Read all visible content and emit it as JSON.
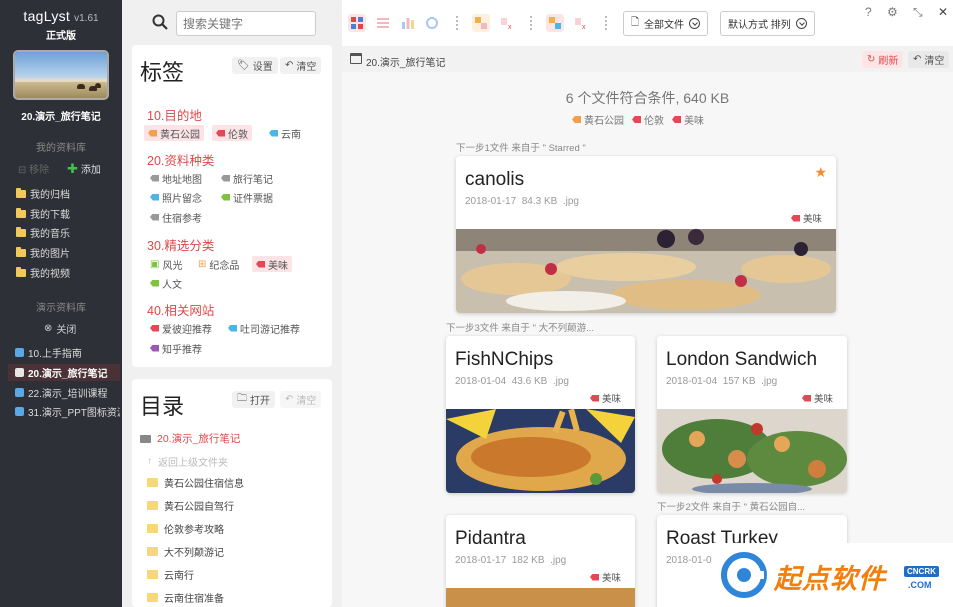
{
  "app": {
    "name": "tagLyst",
    "version": "v1.61",
    "edition": "正式版"
  },
  "sidebar": {
    "library_name": "20.演示_旅行笔记",
    "my_libraries_title": "我的资料库",
    "remove_label": "移除",
    "add_label": "添加",
    "my_folders": [
      "我的归档",
      "我的下载",
      "我的音乐",
      "我的图片",
      "我的视频"
    ],
    "demo_libraries_title": "演示资料库",
    "close_label": "关闭",
    "demo_items": [
      "10.上手指南",
      "20.演示_旅行笔记",
      "22.演示_培训课程",
      "31.演示_PPT图标资源"
    ],
    "active_index": 1
  },
  "search": {
    "placeholder": "搜索关键字"
  },
  "tags_panel": {
    "title": "标签",
    "settings_label": "设置",
    "clear_label": "清空",
    "groups": [
      {
        "name": "10.目的地",
        "tags": [
          "黄石公园",
          "伦敦",
          "云南"
        ]
      },
      {
        "name": "20.资料种类",
        "tags": [
          "地址地图",
          "旅行笔记",
          "照片留念",
          "证件票据",
          "住宿参考"
        ]
      },
      {
        "name": "30.精选分类",
        "tags": [
          "风光",
          "纪念品",
          "美味",
          "人文"
        ]
      },
      {
        "name": "40.相关网站",
        "tags": [
          "爱彼迎推荐",
          "吐司游记推荐",
          "知乎推荐"
        ]
      }
    ]
  },
  "dir_panel": {
    "title": "目录",
    "open_label": "打开",
    "clear_label": "清空",
    "current": "20.演示_旅行笔记",
    "up_label": "返回上级文件夹",
    "folders": [
      "黄石公园住宿信息",
      "黄石公园自驾行",
      "伦敦参考攻略",
      "大不列颠游记",
      "云南行",
      "云南住宿准备"
    ]
  },
  "toolbar": {
    "all_files_label": "全部文件",
    "sort_label": "默认方式 排列",
    "help": "?",
    "settings": "⚙",
    "minimize": "⤡",
    "close": "✕"
  },
  "pathbar": {
    "path": "20.演示_旅行笔记",
    "refresh_label": "刷新",
    "clear_label": "清空"
  },
  "results": {
    "summary": "6 个文件符合条件, 640 KB",
    "filter_tags": [
      "黄石公园",
      "伦敦",
      "美味"
    ],
    "sources": [
      "下一步1文件 来自于 \" Starred \"",
      "下一步3文件 来自于 \" 大不列颠游...",
      "下一步2文件 来自于 \" 黄石公园自..."
    ],
    "cards": [
      {
        "title": "canolis",
        "date": "2018-01-17",
        "size": "84.3 KB",
        "ext": ".jpg",
        "tag": "美味",
        "starred": true
      },
      {
        "title": "FishNChips",
        "date": "2018-01-04",
        "size": "43.6 KB",
        "ext": ".jpg",
        "tag": "美味"
      },
      {
        "title": "London Sandwich",
        "date": "2018-01-04",
        "size": "157 KB",
        "ext": ".jpg",
        "tag": "美味"
      },
      {
        "title": "Pidantra",
        "date": "2018-01-17",
        "size": "182 KB",
        "ext": ".jpg",
        "tag": "美味"
      },
      {
        "title": "Roast Turkey",
        "date": "2018-01-0",
        "size": "",
        "ext": "",
        "tag": ""
      }
    ]
  },
  "watermark": {
    "text": "起点软件",
    "badge": "CNCRK",
    "domain": ".COM"
  },
  "colors": {
    "accent": "#e04848",
    "sidebar_bg": "#2e3037",
    "star": "#f28c2e"
  }
}
